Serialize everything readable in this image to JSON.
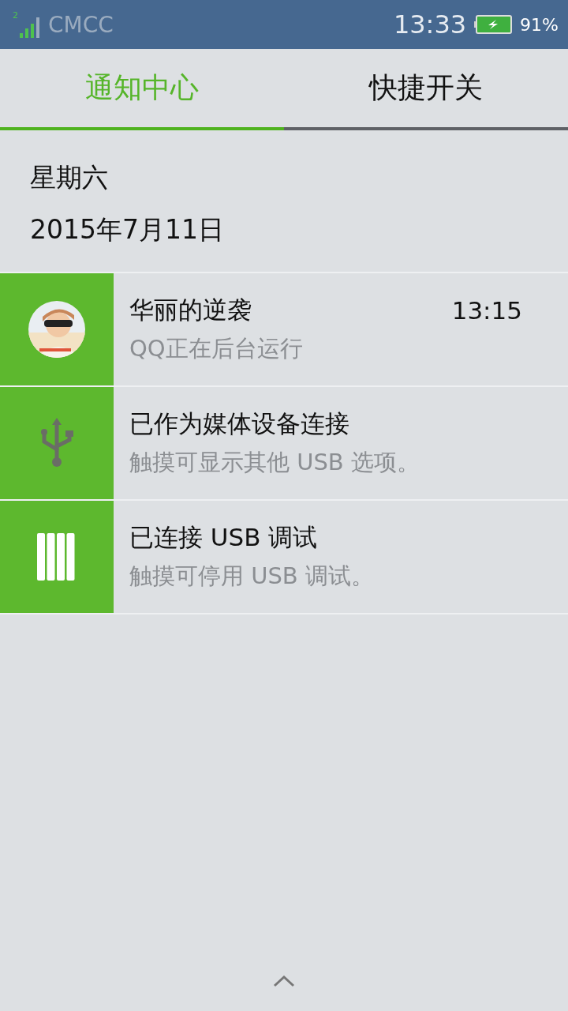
{
  "status_bar": {
    "signal_label": "2",
    "carrier": "CMCC",
    "time": "13:33",
    "battery": "91%"
  },
  "tabs": [
    {
      "label": "通知中心",
      "selected": true
    },
    {
      "label": "快捷开关",
      "selected": false
    }
  ],
  "date": {
    "weekday": "星期六",
    "date": "2015年7月11日"
  },
  "notifications": [
    {
      "title": "华丽的逆袭",
      "subtitle": "QQ正在后台运行",
      "time": "13:15"
    },
    {
      "icon": {
        "kind": "usb"
      },
      "title": "已作为媒体设备连接",
      "subtitle": "触摸可显示其他 USB 选项。"
    },
    {
      "icon": {
        "kind": "debug"
      },
      "title": "已连接 USB 调试",
      "subtitle": "触摸可停用 USB 调试。"
    }
  ]
}
